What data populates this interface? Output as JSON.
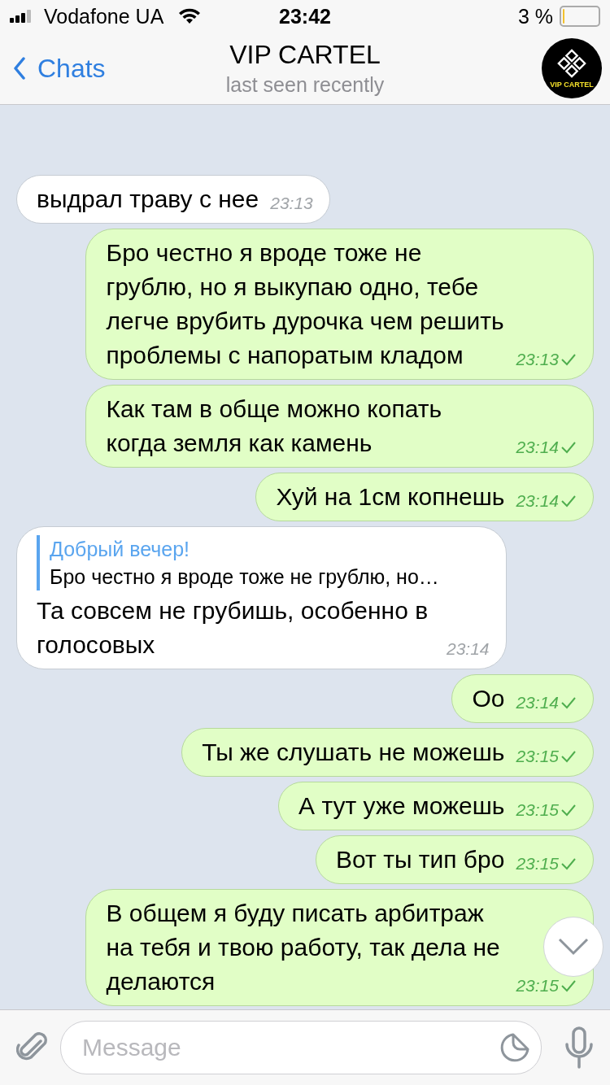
{
  "status_bar": {
    "carrier": "Vodafone UA",
    "time": "23:42",
    "battery_text": "3 %"
  },
  "header": {
    "back_label": "Chats",
    "title": "VIP CARTEL",
    "subtitle": "last seen recently",
    "avatar_label": "VIP CARTEL"
  },
  "messages": [
    {
      "kind": "incoming",
      "text": "выдрал траву с нее",
      "time": "23:13"
    },
    {
      "kind": "outgoing",
      "text": "Бро честно я вроде тоже не грублю, но я выкупаю одно, тебе легче врубить дурочка чем решить проблемы с напоратым кладом",
      "time": "23:13",
      "read": true
    },
    {
      "kind": "outgoing",
      "text": "Как там в обще можно копать когда земля как камень",
      "time": "23:14",
      "read": true
    },
    {
      "kind": "outgoing",
      "text": "Хуй на 1см копнешь",
      "time": "23:14",
      "read": true
    },
    {
      "kind": "incoming",
      "reply": {
        "author": "Добрый вечер!",
        "text": "Бро честно я вроде тоже не грублю, но…"
      },
      "text": "Та совсем не грубишь, особенно в голосовых",
      "time": "23:14"
    },
    {
      "kind": "outgoing",
      "text": "Оо",
      "time": "23:14",
      "read": true
    },
    {
      "kind": "outgoing",
      "text": "Ты же слушать не можешь",
      "time": "23:15",
      "read": true
    },
    {
      "kind": "outgoing",
      "text": "А тут уже можешь",
      "time": "23:15",
      "read": true
    },
    {
      "kind": "outgoing",
      "text": "Вот ты тип бро",
      "time": "23:15",
      "read": true
    },
    {
      "kind": "outgoing",
      "text": "В общем я буду писать арбитраж на тебя и твою работу, так дела не делаются",
      "time": "23:15",
      "read": true
    }
  ],
  "composer": {
    "placeholder": "Message"
  }
}
